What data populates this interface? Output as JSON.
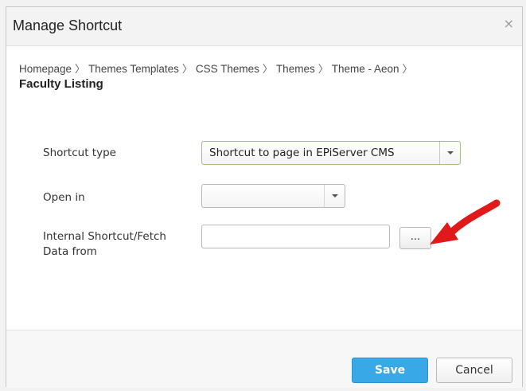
{
  "dialog": {
    "title": "Manage Shortcut",
    "close_glyph": "×"
  },
  "breadcrumb": {
    "items": [
      "Homepage",
      "Themes Templates",
      "CSS Themes",
      "Themes",
      "Theme - Aeon"
    ],
    "separator": "〉",
    "current": "Faculty Listing"
  },
  "form": {
    "shortcut_type": {
      "label": "Shortcut type",
      "value": "Shortcut to page in EPiServer CMS"
    },
    "open_in": {
      "label": "Open in",
      "value": ""
    },
    "internal": {
      "label": "Internal Shortcut/Fetch Data from",
      "value": "",
      "browse_label": "..."
    }
  },
  "footer": {
    "save_label": "Save",
    "cancel_label": "Cancel"
  },
  "colors": {
    "save_button": "#38a8e6",
    "annotation_arrow": "#e01a1a"
  },
  "icons": {
    "close": "close-icon",
    "dropdown": "chevron-down-icon",
    "annotation": "red-arrow-icon"
  }
}
